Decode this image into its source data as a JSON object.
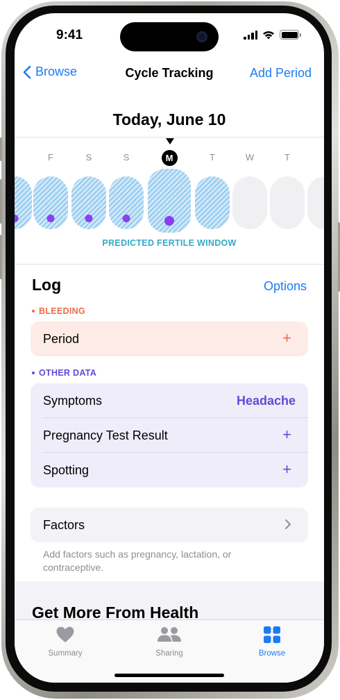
{
  "status_bar": {
    "time": "9:41"
  },
  "nav": {
    "back_label": "Browse",
    "title": "Cycle Tracking",
    "action_label": "Add Period"
  },
  "calendar": {
    "date_title": "Today, June 10",
    "days": [
      {
        "letter": "",
        "state": "fertile",
        "dot": true
      },
      {
        "letter": "F",
        "state": "fertile",
        "dot": true
      },
      {
        "letter": "S",
        "state": "fertile",
        "dot": true
      },
      {
        "letter": "S",
        "state": "fertile",
        "dot": true
      },
      {
        "letter": "M",
        "state": "fertile",
        "dot": true,
        "today": true
      },
      {
        "letter": "T",
        "state": "fertile",
        "dot": false
      },
      {
        "letter": "W",
        "state": "empty",
        "dot": false
      },
      {
        "letter": "T",
        "state": "empty",
        "dot": false
      },
      {
        "letter": "",
        "state": "empty",
        "dot": false
      }
    ],
    "fertile_label": "PREDICTED FERTILE WINDOW",
    "colors": {
      "fertile_fill": "#cde6f7",
      "fertile_stripe": "#80c2ee",
      "dot": "#8a3ff0",
      "label": "#35a9c7"
    }
  },
  "log": {
    "title": "Log",
    "options_label": "Options",
    "bleeding": {
      "section_label": "BLEEDING",
      "color": "#ef6a4b",
      "card_bg": "#fdebe7",
      "rows": [
        {
          "label": "Period",
          "accessory": "+"
        }
      ]
    },
    "other_data": {
      "section_label": "OTHER DATA",
      "color": "#5e4bd9",
      "card_bg": "#efedfa",
      "rows": [
        {
          "label": "Symptoms",
          "value": "Headache"
        },
        {
          "label": "Pregnancy Test Result",
          "accessory": "+"
        },
        {
          "label": "Spotting",
          "accessory": "+"
        }
      ]
    },
    "factors": {
      "label": "Factors",
      "note": "Add factors such as pregnancy, lactation, or contraceptive."
    }
  },
  "more": {
    "title": "Get More From Health"
  },
  "tabbar": {
    "items": [
      {
        "label": "Summary",
        "icon": "heart-icon",
        "active": false
      },
      {
        "label": "Sharing",
        "icon": "people-icon",
        "active": false
      },
      {
        "label": "Browse",
        "icon": "grid-icon",
        "active": true
      }
    ],
    "active_color": "#1a7cf5",
    "inactive_color": "#8e8e93"
  }
}
